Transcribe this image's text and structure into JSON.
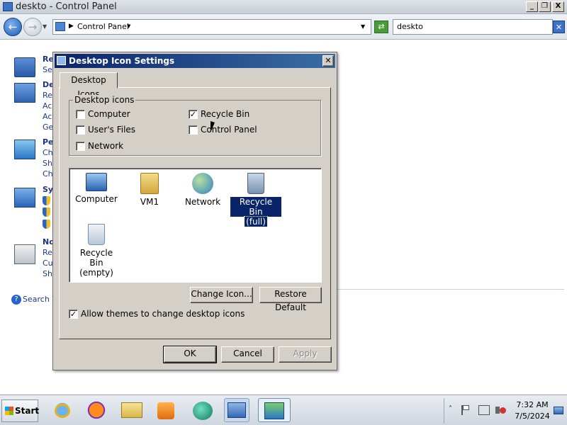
{
  "window": {
    "title": "deskto - Control Panel",
    "controls": {
      "minimize": "_",
      "restore": "❐",
      "close": "X"
    }
  },
  "address": {
    "breadcrumb": "Control Panel",
    "search_value": "deskto"
  },
  "control_panel": {
    "sections": [
      {
        "title": "Re",
        "lines": [
          "Se"
        ]
      },
      {
        "title": "De",
        "lines": [
          "Re",
          "Ac",
          "Ac",
          "Ge"
        ]
      },
      {
        "title": "Pe",
        "lines": [
          "Ch",
          "Sh",
          "Ch"
        ]
      },
      {
        "title": "Sy",
        "lines": [
          "",
          "",
          ""
        ]
      },
      {
        "title": "No",
        "lines": [
          "Re",
          "Cu",
          "Sh"
        ]
      }
    ],
    "search_link": "Search W"
  },
  "dialog": {
    "title": "Desktop Icon Settings",
    "tab": "Desktop Icons",
    "group_label": "Desktop icons",
    "checkboxes": [
      {
        "label": "Computer",
        "checked": false
      },
      {
        "label": "Recycle Bin",
        "checked": true
      },
      {
        "label": "User's Files",
        "checked": false
      },
      {
        "label": "Control Panel",
        "checked": false
      },
      {
        "label": "Network",
        "checked": false
      }
    ],
    "icons": [
      {
        "label": "Computer",
        "icon": "computer-icon"
      },
      {
        "label": "VM1",
        "icon": "user-folder-icon"
      },
      {
        "label": "Network",
        "icon": "network-globe-icon"
      },
      {
        "label": "Recycle Bin (full)",
        "label_line1": "Recycle Bin",
        "label_line2": "(full)",
        "icon": "recycle-bin-full-icon",
        "selected": true
      },
      {
        "label": "Recycle Bin (empty)",
        "label_line1": "Recycle Bin",
        "label_line2": "(empty)",
        "icon": "recycle-bin-empty-icon"
      }
    ],
    "change_icon": "Change Icon...",
    "restore_default": "Restore Default",
    "allow_themes": "Allow themes to change desktop icons",
    "allow_themes_checked": true,
    "ok": "OK",
    "cancel": "Cancel",
    "apply": "Apply"
  },
  "taskbar": {
    "start": "Start",
    "apps": [
      "internet-explorer-icon",
      "firefox-icon",
      "file-explorer-icon",
      "media-player-icon",
      "app-green-icon",
      "server-manager-icon",
      "control-panel-icon"
    ],
    "time": "7:32 AM",
    "date": "7/5/2024"
  }
}
